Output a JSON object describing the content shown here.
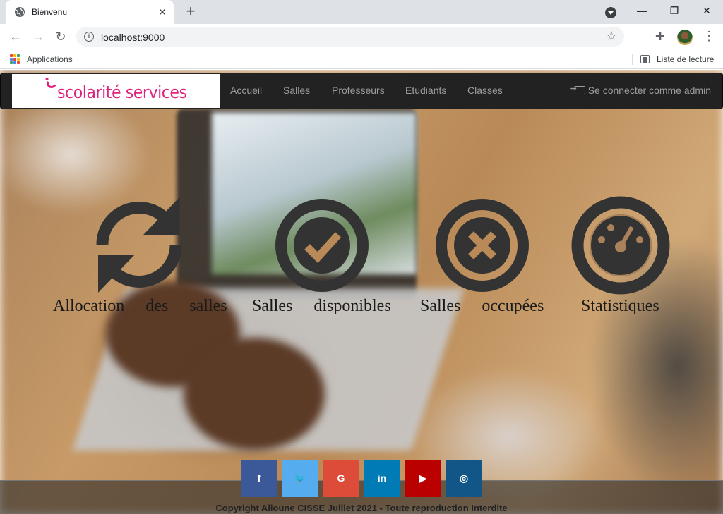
{
  "browser": {
    "tab_title": "Bienvenu",
    "url": "localhost:9000",
    "bookmark_apps": "Applications",
    "reading_list": "Liste de lecture",
    "window_controls": {
      "minimize": "—",
      "restore": "❐",
      "close": "✕"
    }
  },
  "navbar": {
    "brand": "scolarité services",
    "links": [
      "Accueil",
      "Salles",
      "Professeurs",
      "Etudiants",
      "Classes"
    ],
    "admin_login": "Se connecter comme admin"
  },
  "features": [
    {
      "icon": "refresh-icon",
      "label": "Allocation des salles"
    },
    {
      "icon": "check-circle-icon",
      "label": "Salles disponibles"
    },
    {
      "icon": "times-circle-icon",
      "label": "Salles occupées"
    },
    {
      "icon": "dashboard-icon",
      "label": "Statistiques"
    }
  ],
  "social": [
    {
      "icon": "facebook-icon",
      "glyph": "f",
      "color": "#3b5998"
    },
    {
      "icon": "twitter-icon",
      "glyph": "🐦",
      "color": "#55acee"
    },
    {
      "icon": "google-icon",
      "glyph": "G",
      "color": "#dd4b39"
    },
    {
      "icon": "linkedin-icon",
      "glyph": "in",
      "color": "#007bb5"
    },
    {
      "icon": "youtube-icon",
      "glyph": "▶",
      "color": "#bb0000"
    },
    {
      "icon": "instagram-icon",
      "glyph": "◎",
      "color": "#125688"
    }
  ],
  "footer": {
    "copyright": "Copyright Alioune CISSE Juillet 2021 - Toute reproduction Interdite"
  },
  "colors": {
    "brand": "#e0247e",
    "navbar": "#222222",
    "nav_text": "#9d9d9d",
    "icon": "#333333"
  }
}
